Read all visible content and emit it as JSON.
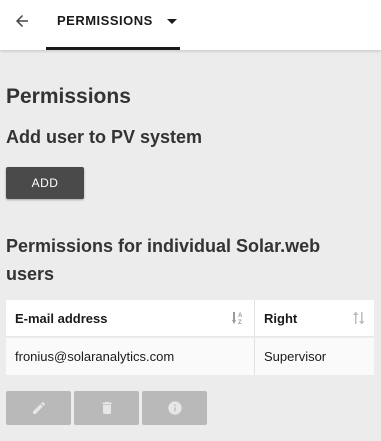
{
  "header": {
    "back_icon": "arrow-left-icon",
    "tab_label": "PERMISSIONS",
    "tab_dropdown_icon": "caret-down-icon"
  },
  "main": {
    "title": "Permissions",
    "add_section_title": "Add user to PV system",
    "add_button_label": "ADD",
    "permissions_section_title": "Permissions for individual Solar.web users"
  },
  "table": {
    "columns": [
      {
        "label": "E-mail address",
        "sort_icon": "sort-alpha-icon"
      },
      {
        "label": "Right",
        "sort_icon": "sort-icon"
      }
    ],
    "rows": [
      {
        "email": "fronius@solaranalytics.com",
        "right": "Supervisor"
      }
    ]
  },
  "actions": [
    {
      "icon": "edit-icon"
    },
    {
      "icon": "trash-icon"
    },
    {
      "icon": "info-icon"
    }
  ],
  "colors": {
    "background": "#ececec",
    "add_button": "#4a4a4a",
    "action_button_disabled": "#b9b9b9"
  }
}
